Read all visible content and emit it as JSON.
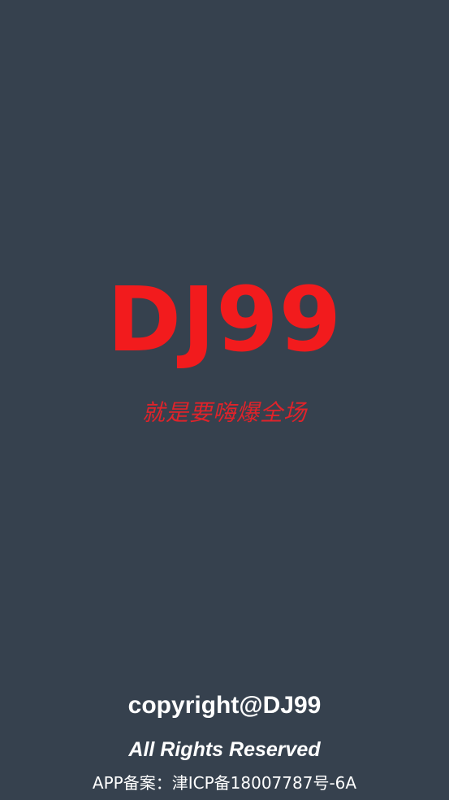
{
  "splash": {
    "brand_title": "DJ99",
    "tagline": "就是要嗨爆全场",
    "copyright": "copyright@DJ99",
    "rights": "All Rights Reserved",
    "icp_record": "APP备案：津ICP备18007787号-6A"
  },
  "colors": {
    "background": "#36414e",
    "brand_red": "#f21b1d",
    "tagline_red": "#e0232a",
    "footer_text": "#ffffff"
  }
}
